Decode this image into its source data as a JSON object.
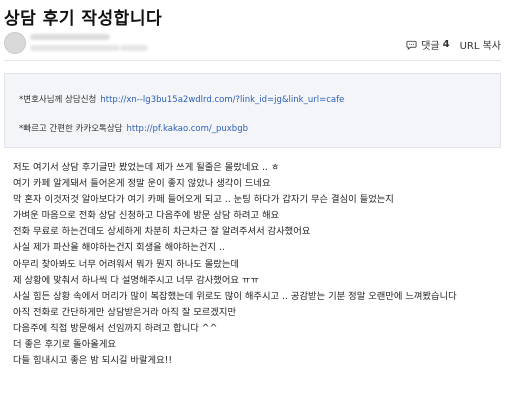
{
  "post": {
    "title": "상담 후기 작성합니다"
  },
  "meta": {
    "comment_label": "댓글",
    "comment_count": "4",
    "url_copy": "URL 복사"
  },
  "links": [
    {
      "label": "*변호사님께 상담신청",
      "url": "http://xn--lg3bu15a2wdlrd.com/?link_id=jg&link_url=cafe"
    },
    {
      "label": "*빠르고 간편한 카카오톡상담",
      "url": "http://pf.kakao.com/_puxbgb"
    }
  ],
  "body_lines": [
    "저도 여기서 상담 후기글만 봤었는데 제가 쓰게 될줄은 몰랐네요 .. ㅎ",
    "여기 카페 알게돼서 들어온게 정말 운이 좋지 않았나 생각이 드네요",
    "막 혼자 이것저것 알아보다가 여기 카페 들어오게 되고 .. 눈팅 하다가 갑자기 무슨 결심이 들었는지",
    "가벼운 마음으로 전화 상담 신청하고 다음주에 방문 상담 하려고 해요",
    "전화 무료로 하는건데도 상세하게 차분히 차근차근 잘 알려주셔서 감사했어요",
    "사실 제가 파산을 해야하는건지 회생을 해야하는건지 ..",
    "아무리 찾아봐도 너무 어려워서 뭐가 뭔지 하나도 몰랐는데",
    "제 상황에 맞춰서 하나씩 다 설명해주시고 너무 감사했어요 ㅠㅠ",
    "사실 힘든 상황 속에서 머리가 많이 복잡했는데 위로도 많이 해주시고 .. 공감받는 기분 정말 오랜만에 느껴봤습니다",
    "아직 전화로 간단하게만 상담받은거라 아직 잘 모르겠지만",
    "다음주에 직접 방문해서 선임까지 하려고 합니다 ^^",
    "더 좋은 후기로 돌아올게요",
    "다들 힘내시고 좋은 밤 되시길 바랄게요!!"
  ]
}
